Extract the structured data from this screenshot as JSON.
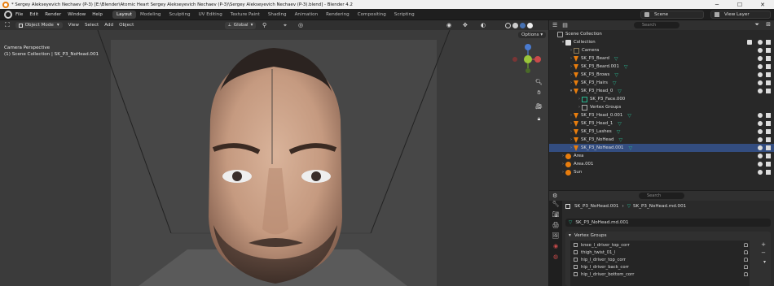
{
  "window": {
    "title": "* Sergey Alekseyevich Nechaev (P-3) [E:\\Blender\\Atomic Heart Sergey Aleksеyevich Nechaev (P-3)\\Sergey Alekseyevich Nechaev (P-3).blend] - Blender 4.2"
  },
  "menu": [
    "File",
    "Edit",
    "Render",
    "Window",
    "Help"
  ],
  "tabs": [
    "Layout",
    "Modeling",
    "Sculpting",
    "UV Editing",
    "Texture Paint",
    "Shading",
    "Animation",
    "Rendering",
    "Compositing",
    "Scripting"
  ],
  "active_tab": "Layout",
  "scene": {
    "label": "Scene",
    "view_layer": "View Layer"
  },
  "viewport_header": {
    "mode": "Object Mode",
    "items": [
      "View",
      "Select",
      "Add",
      "Object"
    ],
    "orientation": "Global",
    "options": "Options"
  },
  "overlay": {
    "line1": "Camera Perspective",
    "line2": "(1) Scene Collection | SK_P3_NoHead.001"
  },
  "gizmo": {
    "z": "Z",
    "y": "Y",
    "x": "X"
  },
  "outliner": {
    "search_placeholder": "Search",
    "scene_collection": "Scene Collection",
    "collection": "Collection",
    "items": [
      {
        "name": "Camera",
        "type": "camera",
        "indent": 2
      },
      {
        "name": "SK_P3_Beard",
        "type": "mesh",
        "indent": 2
      },
      {
        "name": "SK_P3_Beard.001",
        "type": "mesh",
        "indent": 2
      },
      {
        "name": "SK_P3_Brows",
        "type": "mesh",
        "indent": 2
      },
      {
        "name": "SK_P3_Hairs",
        "type": "mesh",
        "indent": 2
      },
      {
        "name": "SK_P3_Head_0",
        "type": "mesh",
        "indent": 2,
        "expanded": true
      },
      {
        "name": "SK_P3_Face.000",
        "type": "data",
        "indent": 3
      },
      {
        "name": "Vertex Groups",
        "type": "group",
        "indent": 3
      },
      {
        "name": "SK_P3_Head_0.001",
        "type": "mesh",
        "indent": 2
      },
      {
        "name": "SK_P3_Head_1",
        "type": "mesh",
        "indent": 2
      },
      {
        "name": "SK_P3_Lashes",
        "type": "mesh",
        "indent": 2
      },
      {
        "name": "SK_P3_NoHead",
        "type": "mesh",
        "indent": 2
      },
      {
        "name": "SK_P3_NoHead.001",
        "type": "mesh",
        "indent": 2,
        "selected": true
      },
      {
        "name": "Area",
        "type": "light",
        "indent": 1
      },
      {
        "name": "Area.001",
        "type": "light",
        "indent": 1
      },
      {
        "name": "Sun",
        "type": "light",
        "indent": 1
      }
    ]
  },
  "properties": {
    "search_placeholder": "Search",
    "breadcrumb_object": "SK_P3_NoHead.001",
    "breadcrumb_data": "SK_P3_NoHead.md.001",
    "data_name": "SK_P3_NoHead.md.001",
    "panel_title": "Vertex Groups",
    "vertex_groups": [
      "knee_l_driver_top_corr",
      "thigh_twist_01_l",
      "hip_l_driver_top_corr",
      "hip_l_driver_back_corr",
      "hip_l_driver_bottom_corr"
    ]
  },
  "colors": {
    "accent": "#4772b3",
    "mesh": "#28b58f",
    "object": "#e87d0d",
    "selected_row": "#334d80"
  }
}
